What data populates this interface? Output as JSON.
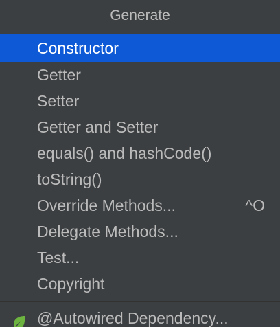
{
  "popup": {
    "title": "Generate"
  },
  "menu": {
    "items": [
      {
        "label": "Constructor",
        "selected": true
      },
      {
        "label": "Getter"
      },
      {
        "label": "Setter"
      },
      {
        "label": "Getter and Setter"
      },
      {
        "label": "equals() and hashCode()"
      },
      {
        "label": "toString()"
      },
      {
        "label": "Override Methods...",
        "shortcut": "^O"
      },
      {
        "label": "Delegate Methods..."
      },
      {
        "label": "Test..."
      },
      {
        "label": "Copyright"
      }
    ],
    "extra_item": {
      "label": "@Autowired Dependency...",
      "icon": "spring-leaf-icon",
      "icon_color": "#6db33f"
    }
  },
  "colors": {
    "background": "#3c3f41",
    "selection": "#0d59d6",
    "text": "#bbbbbb",
    "selected_text": "#ffffff"
  }
}
